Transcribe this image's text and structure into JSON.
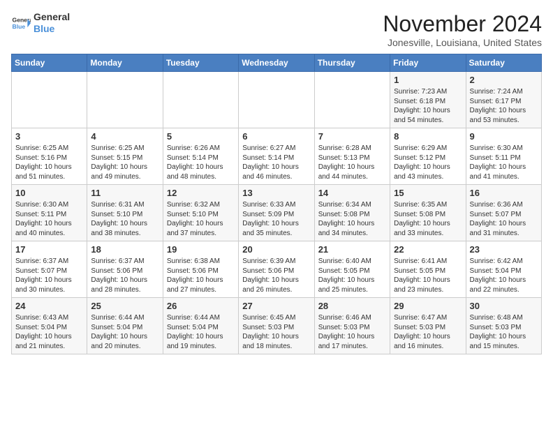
{
  "header": {
    "logo_general": "General",
    "logo_blue": "Blue",
    "month_title": "November 2024",
    "subtitle": "Jonesville, Louisiana, United States"
  },
  "days_of_week": [
    "Sunday",
    "Monday",
    "Tuesday",
    "Wednesday",
    "Thursday",
    "Friday",
    "Saturday"
  ],
  "weeks": [
    [
      {
        "day": "",
        "content": ""
      },
      {
        "day": "",
        "content": ""
      },
      {
        "day": "",
        "content": ""
      },
      {
        "day": "",
        "content": ""
      },
      {
        "day": "",
        "content": ""
      },
      {
        "day": "1",
        "content": "Sunrise: 7:23 AM\nSunset: 6:18 PM\nDaylight: 10 hours and 54 minutes."
      },
      {
        "day": "2",
        "content": "Sunrise: 7:24 AM\nSunset: 6:17 PM\nDaylight: 10 hours and 53 minutes."
      }
    ],
    [
      {
        "day": "3",
        "content": "Sunrise: 6:25 AM\nSunset: 5:16 PM\nDaylight: 10 hours and 51 minutes."
      },
      {
        "day": "4",
        "content": "Sunrise: 6:25 AM\nSunset: 5:15 PM\nDaylight: 10 hours and 49 minutes."
      },
      {
        "day": "5",
        "content": "Sunrise: 6:26 AM\nSunset: 5:14 PM\nDaylight: 10 hours and 48 minutes."
      },
      {
        "day": "6",
        "content": "Sunrise: 6:27 AM\nSunset: 5:14 PM\nDaylight: 10 hours and 46 minutes."
      },
      {
        "day": "7",
        "content": "Sunrise: 6:28 AM\nSunset: 5:13 PM\nDaylight: 10 hours and 44 minutes."
      },
      {
        "day": "8",
        "content": "Sunrise: 6:29 AM\nSunset: 5:12 PM\nDaylight: 10 hours and 43 minutes."
      },
      {
        "day": "9",
        "content": "Sunrise: 6:30 AM\nSunset: 5:11 PM\nDaylight: 10 hours and 41 minutes."
      }
    ],
    [
      {
        "day": "10",
        "content": "Sunrise: 6:30 AM\nSunset: 5:11 PM\nDaylight: 10 hours and 40 minutes."
      },
      {
        "day": "11",
        "content": "Sunrise: 6:31 AM\nSunset: 5:10 PM\nDaylight: 10 hours and 38 minutes."
      },
      {
        "day": "12",
        "content": "Sunrise: 6:32 AM\nSunset: 5:10 PM\nDaylight: 10 hours and 37 minutes."
      },
      {
        "day": "13",
        "content": "Sunrise: 6:33 AM\nSunset: 5:09 PM\nDaylight: 10 hours and 35 minutes."
      },
      {
        "day": "14",
        "content": "Sunrise: 6:34 AM\nSunset: 5:08 PM\nDaylight: 10 hours and 34 minutes."
      },
      {
        "day": "15",
        "content": "Sunrise: 6:35 AM\nSunset: 5:08 PM\nDaylight: 10 hours and 33 minutes."
      },
      {
        "day": "16",
        "content": "Sunrise: 6:36 AM\nSunset: 5:07 PM\nDaylight: 10 hours and 31 minutes."
      }
    ],
    [
      {
        "day": "17",
        "content": "Sunrise: 6:37 AM\nSunset: 5:07 PM\nDaylight: 10 hours and 30 minutes."
      },
      {
        "day": "18",
        "content": "Sunrise: 6:37 AM\nSunset: 5:06 PM\nDaylight: 10 hours and 28 minutes."
      },
      {
        "day": "19",
        "content": "Sunrise: 6:38 AM\nSunset: 5:06 PM\nDaylight: 10 hours and 27 minutes."
      },
      {
        "day": "20",
        "content": "Sunrise: 6:39 AM\nSunset: 5:06 PM\nDaylight: 10 hours and 26 minutes."
      },
      {
        "day": "21",
        "content": "Sunrise: 6:40 AM\nSunset: 5:05 PM\nDaylight: 10 hours and 25 minutes."
      },
      {
        "day": "22",
        "content": "Sunrise: 6:41 AM\nSunset: 5:05 PM\nDaylight: 10 hours and 23 minutes."
      },
      {
        "day": "23",
        "content": "Sunrise: 6:42 AM\nSunset: 5:04 PM\nDaylight: 10 hours and 22 minutes."
      }
    ],
    [
      {
        "day": "24",
        "content": "Sunrise: 6:43 AM\nSunset: 5:04 PM\nDaylight: 10 hours and 21 minutes."
      },
      {
        "day": "25",
        "content": "Sunrise: 6:44 AM\nSunset: 5:04 PM\nDaylight: 10 hours and 20 minutes."
      },
      {
        "day": "26",
        "content": "Sunrise: 6:44 AM\nSunset: 5:04 PM\nDaylight: 10 hours and 19 minutes."
      },
      {
        "day": "27",
        "content": "Sunrise: 6:45 AM\nSunset: 5:03 PM\nDaylight: 10 hours and 18 minutes."
      },
      {
        "day": "28",
        "content": "Sunrise: 6:46 AM\nSunset: 5:03 PM\nDaylight: 10 hours and 17 minutes."
      },
      {
        "day": "29",
        "content": "Sunrise: 6:47 AM\nSunset: 5:03 PM\nDaylight: 10 hours and 16 minutes."
      },
      {
        "day": "30",
        "content": "Sunrise: 6:48 AM\nSunset: 5:03 PM\nDaylight: 10 hours and 15 minutes."
      }
    ]
  ]
}
